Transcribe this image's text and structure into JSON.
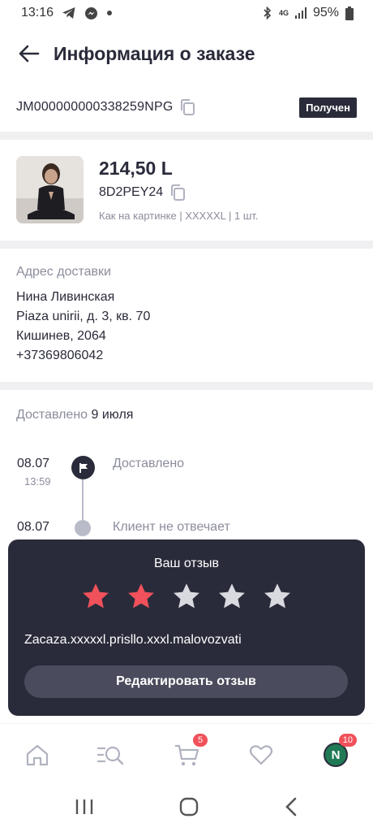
{
  "status_bar": {
    "time": "13:16",
    "battery": "95%",
    "network": "4G"
  },
  "header": {
    "title": "Информация о заказе"
  },
  "order": {
    "id": "JM000000000338259NPG",
    "status": "Получен"
  },
  "product": {
    "price": "214,50 L",
    "sku": "8D2PEY24",
    "variant": "Как на картинке | XXXXXL | 1 шт."
  },
  "address": {
    "label": "Адрес доставки",
    "name": "Нина Ливинская",
    "street": "Piaza unirii, д. 3, кв. 70",
    "city": "Кишинев, 2064",
    "phone": "+37369806042"
  },
  "delivery": {
    "prefix": "Доставлено",
    "date": "9 июля"
  },
  "timeline": [
    {
      "date": "08.07",
      "time": "13:59",
      "label": "Доставлено"
    },
    {
      "date": "08.07",
      "time": "",
      "label": "Клиент не отвечает"
    }
  ],
  "review": {
    "title": "Ваш отзыв",
    "rating": 2,
    "max_rating": 5,
    "text": "Zacaza.xxxxxl.prisllo.xxxl.malovozvati",
    "edit_label": "Редактировать отзыв"
  },
  "bottom_nav": {
    "cart_badge": "5",
    "profile_badge": "10",
    "profile_initial": "N"
  },
  "colors": {
    "primary": "#2a2b3a",
    "star_active": "#f0515b",
    "star_inactive": "#d9dae0",
    "muted": "#8b8d9c"
  }
}
